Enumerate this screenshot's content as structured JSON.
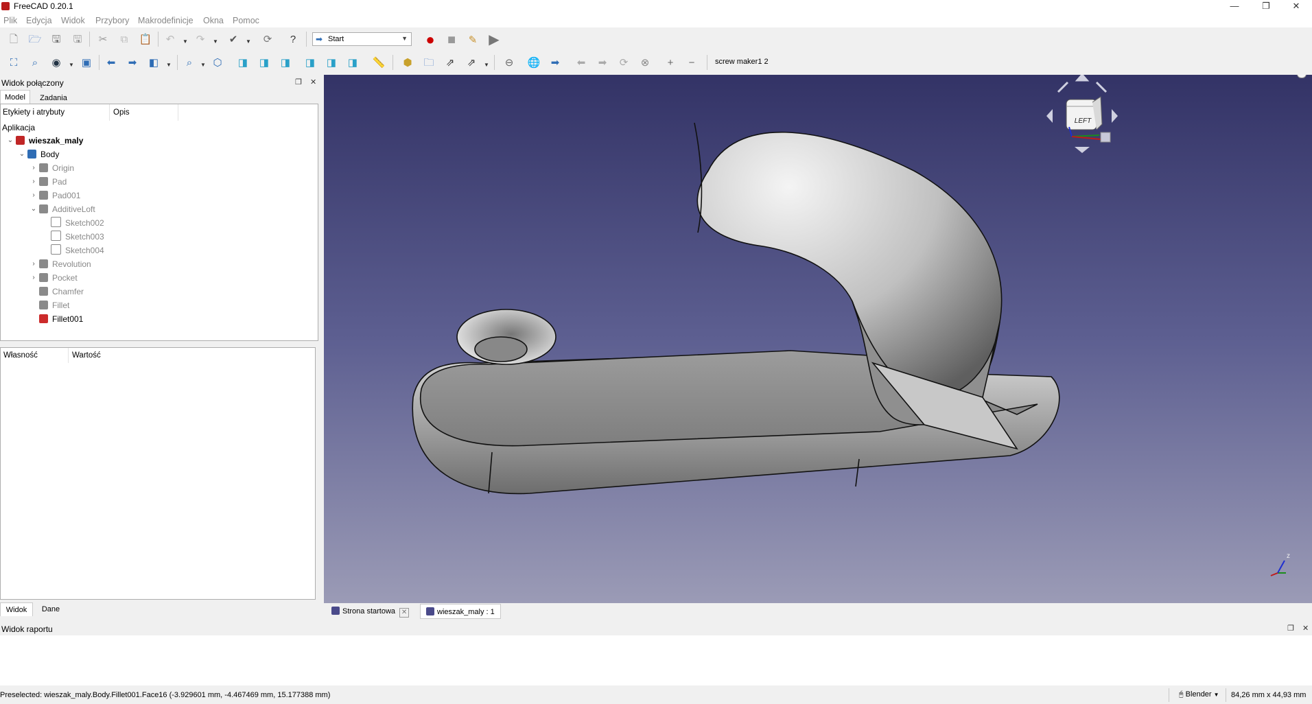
{
  "window": {
    "title": "FreeCAD 0.20.1",
    "minimize_glyph": "—",
    "maximize_glyph": "❐",
    "close_glyph": "✕"
  },
  "menu": [
    "Plik",
    "Edycja",
    "Widok",
    "Przybory",
    "Makrodefinicje",
    "Okna",
    "Pomoc"
  ],
  "toolbar": {
    "workbench": "Start",
    "macro_label": "screw maker1 2",
    "icons": {
      "file": [
        "new-document-icon",
        "open-icon",
        "save-icon",
        "save-as-icon",
        "cut-icon",
        "copy-icon",
        "paste-icon",
        "undo-icon",
        "redo-icon",
        "refresh-icon",
        "whats-this-icon"
      ],
      "macro": [
        "record-macro-icon",
        "stop-macro-icon",
        "edit-macro-icon",
        "run-macro-icon"
      ],
      "view": [
        "fit-all-icon",
        "fit-selection-icon",
        "draw-style-icon",
        "bounding-box-icon",
        "back-icon",
        "forward-icon",
        "sync-view-icon",
        "std-view-menu-icon",
        "isometric-icon",
        "front-view-icon",
        "top-view-icon",
        "right-view-icon",
        "rear-view-icon",
        "bottom-view-icon",
        "left-view-icon",
        "measure-icon"
      ],
      "structure": [
        "create-part-icon",
        "create-group-icon",
        "link-icon",
        "link-actions-icon"
      ],
      "web": [
        "navigation-icon",
        "web-browser-icon",
        "web-navigate-icon",
        "web-back-icon",
        "web-forward-icon",
        "web-refresh-icon",
        "web-stop-icon",
        "zoom-in-icon",
        "zoom-out-icon"
      ]
    }
  },
  "combo_view": {
    "title": "Widok połączony",
    "tabs": [
      "Model",
      "Zadania"
    ],
    "active_tab": "Model",
    "columns": [
      "Etykiety i atrybuty",
      "Opis"
    ],
    "root_label": "Aplikacja",
    "tree": [
      {
        "label": "wieszak_maly",
        "level": 0,
        "expander": "v",
        "bold": true,
        "icon": "document-icon",
        "greyed": false
      },
      {
        "label": "Body",
        "level": 1,
        "expander": "v",
        "bold": false,
        "icon": "body-icon",
        "greyed": false
      },
      {
        "label": "Origin",
        "level": 2,
        "expander": ">",
        "bold": false,
        "icon": "origin-icon",
        "greyed": true
      },
      {
        "label": "Pad",
        "level": 2,
        "expander": ">",
        "bold": false,
        "icon": "pad-icon",
        "greyed": true
      },
      {
        "label": "Pad001",
        "level": 2,
        "expander": ">",
        "bold": false,
        "icon": "pad-icon",
        "greyed": true
      },
      {
        "label": "AdditiveLoft",
        "level": 2,
        "expander": "v",
        "bold": false,
        "icon": "loft-icon",
        "greyed": true
      },
      {
        "label": "Sketch002",
        "level": 3,
        "expander": "",
        "bold": false,
        "icon": "sketch-icon",
        "greyed": true
      },
      {
        "label": "Sketch003",
        "level": 3,
        "expander": "",
        "bold": false,
        "icon": "sketch-icon",
        "greyed": true
      },
      {
        "label": "Sketch004",
        "level": 3,
        "expander": "",
        "bold": false,
        "icon": "sketch-icon",
        "greyed": true
      },
      {
        "label": "Revolution",
        "level": 2,
        "expander": ">",
        "bold": false,
        "icon": "revolution-icon",
        "greyed": true
      },
      {
        "label": "Pocket",
        "level": 2,
        "expander": ">",
        "bold": false,
        "icon": "pocket-icon",
        "greyed": true
      },
      {
        "label": "Chamfer",
        "level": 2,
        "expander": "",
        "bold": false,
        "icon": "chamfer-icon",
        "greyed": true
      },
      {
        "label": "Fillet",
        "level": 2,
        "expander": "",
        "bold": false,
        "icon": "fillet-icon",
        "greyed": true
      },
      {
        "label": "Fillet001",
        "level": 2,
        "expander": "",
        "bold": false,
        "icon": "fillet-tip-icon",
        "greyed": false
      }
    ],
    "property_columns": [
      "Własność",
      "Wartość"
    ],
    "bottom_tabs": [
      "Widok",
      "Dane"
    ]
  },
  "navcube": {
    "face_label": "LEFT",
    "axis_label": "z"
  },
  "doc_tabs": [
    {
      "label": "Strona startowa",
      "active": false
    },
    {
      "label": "wieszak_maly : 1",
      "active": true
    }
  ],
  "report": {
    "title": "Widok raportu"
  },
  "statusbar": {
    "message": "Preselected: wieszak_maly.Body.Fillet001.Face16 (-3.929601 mm, -4.467469 mm, 15.177388 mm)",
    "nav_style": "Blender",
    "dimensions": "84,26 mm x 44,93 mm"
  }
}
